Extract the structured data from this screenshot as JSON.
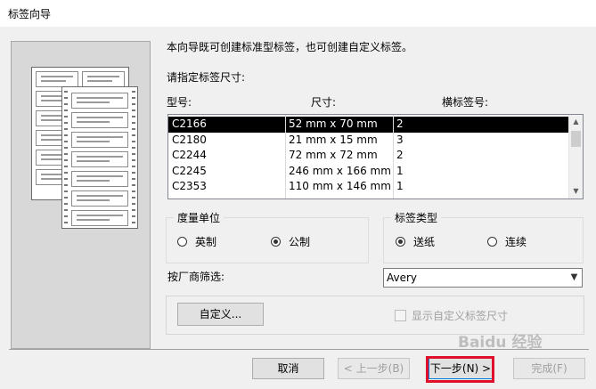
{
  "window": {
    "title": "标签向导"
  },
  "intro": {
    "description": "本向导既可创建标准型标签，也可创建自定义标签。",
    "specify_size": "请指定标签尺寸:"
  },
  "columns": {
    "model": "型号:",
    "size": "尺寸:",
    "across": "横标签号:"
  },
  "labels": [
    {
      "model": "C2166",
      "size": "52 mm x 70 mm",
      "across": "2",
      "selected": true
    },
    {
      "model": "C2180",
      "size": "21 mm x 15 mm",
      "across": "3",
      "selected": false
    },
    {
      "model": "C2244",
      "size": "72 mm x 72 mm",
      "across": "2",
      "selected": false
    },
    {
      "model": "C2245",
      "size": "246 mm x 166 mm",
      "across": "1",
      "selected": false
    },
    {
      "model": "C2353",
      "size": "110 mm x 146 mm",
      "across": "1",
      "selected": false
    }
  ],
  "units": {
    "legend": "度量单位",
    "options": [
      "英制",
      "公制"
    ],
    "selected": "公制"
  },
  "label_type": {
    "legend": "标签类型",
    "options": [
      "送纸",
      "连续"
    ],
    "selected": "送纸"
  },
  "filter": {
    "label": "按厂商筛选:",
    "value": "Avery"
  },
  "custom": {
    "button": "自定义...",
    "show_custom": "显示自定义标签尺寸"
  },
  "buttons": {
    "cancel": "取消",
    "back": "< 上一步(B)",
    "next": "下一步(N) >",
    "finish": "完成(F)"
  },
  "icons": {
    "scroll_up": "chevron-up-icon",
    "scroll_down": "chevron-down-icon",
    "dropdown": "chevron-down-icon"
  },
  "colors": {
    "highlight": "#e0102a",
    "selected_row": "#000000"
  },
  "watermark": "Baidu 经验"
}
